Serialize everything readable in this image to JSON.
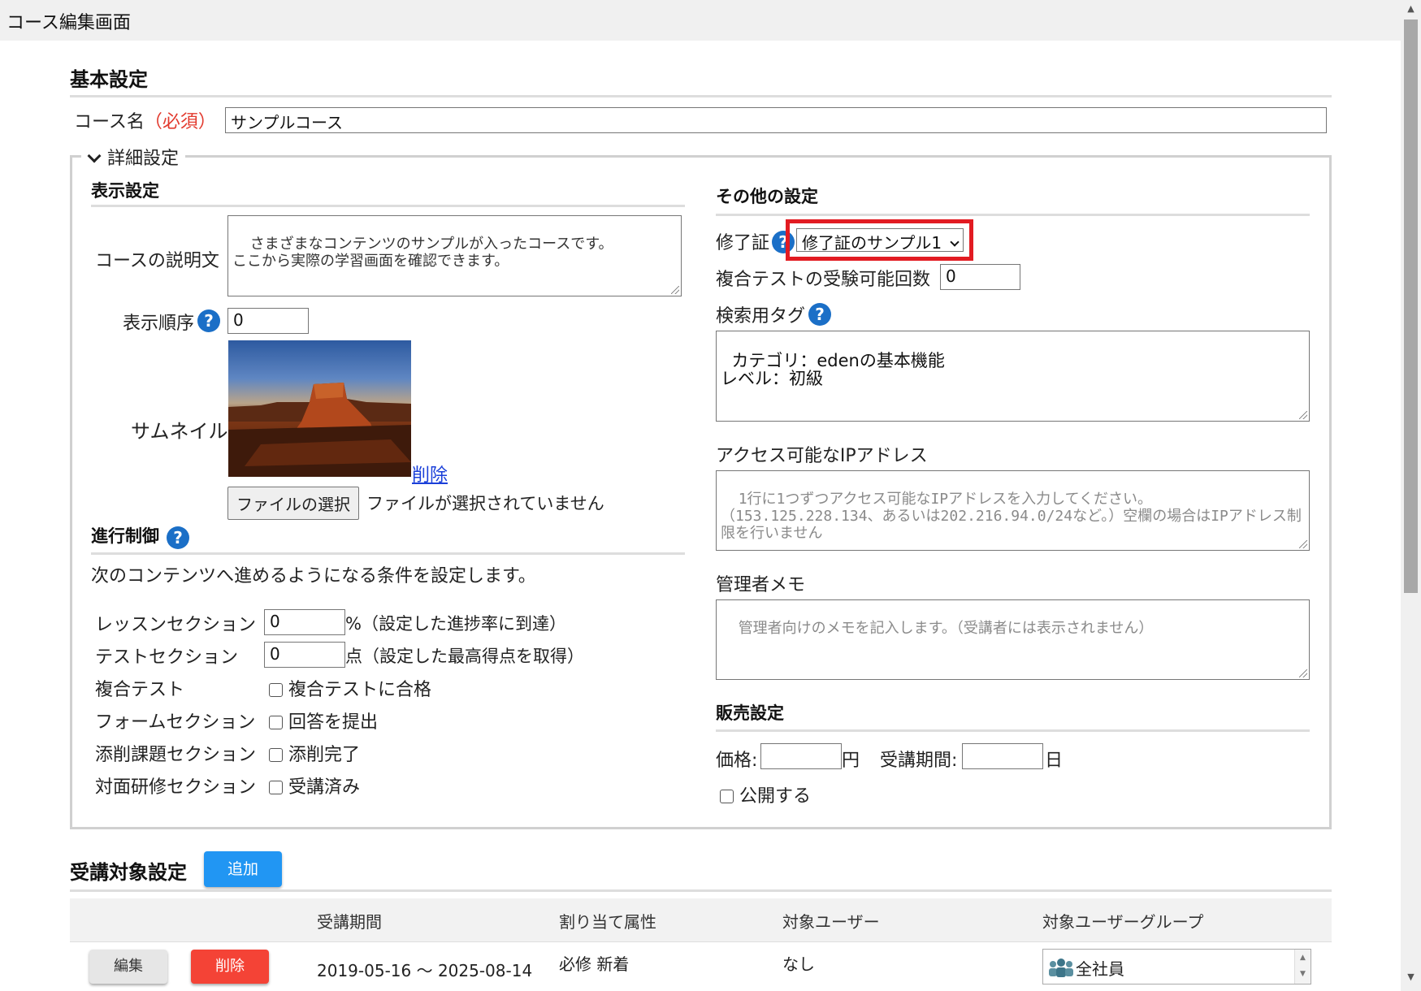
{
  "window": {
    "title": "コース編集画面"
  },
  "basic": {
    "heading": "基本設定",
    "course_name_label": "コース名",
    "required": "（必須）",
    "course_name_value": "サンプルコース"
  },
  "details": {
    "toggle_label": "詳細設定",
    "display": {
      "heading": "表示設定",
      "description_label": "コースの説明文",
      "description_value": "さまざまなコンテンツのサンプルが入ったコースです。\nここから実際の学習画面を確認できます。",
      "order_label": "表示順序",
      "order_value": "0",
      "thumbnail_label": "サムネイル",
      "delete_link": "削除",
      "file_button": "ファイルの選択",
      "file_status": "ファイルが選択されていません"
    },
    "progress": {
      "heading": "進行制御",
      "intro": "次のコンテンツへ進めるようになる条件を設定します。",
      "rows": [
        {
          "label": "レッスンセクション",
          "value": "0",
          "suffix": "%（設定した進捗率に到達）"
        },
        {
          "label": "テストセクション",
          "value": "0",
          "suffix": "点（設定した最高得点を取得）"
        }
      ],
      "checks": [
        {
          "label": "複合テスト",
          "option": "複合テストに合格"
        },
        {
          "label": "フォームセクション",
          "option": "回答を提出"
        },
        {
          "label": "添削課題セクション",
          "option": "添削完了"
        },
        {
          "label": "対面研修セクション",
          "option": "受講済み"
        }
      ]
    },
    "other": {
      "heading": "その他の設定",
      "certificate_label": "修了証",
      "certificate_value": "修了証のサンプル1",
      "attempts_label": "複合テストの受験可能回数",
      "attempts_value": "0",
      "tags_label": "検索用タグ",
      "tags_value": "カテゴリ：edenの基本機能\nレベル：初級",
      "ip_label": "アクセス可能なIPアドレス",
      "ip_placeholder": "1行に1つずつアクセス可能なIPアドレスを入力してください。\n（153.125.228.134、あるいは202.216.94.0/24など。）空欄の場合はIPアドレス制限を行いません",
      "memo_label": "管理者メモ",
      "memo_placeholder": "管理者向けのメモを記入します。（受講者には表示されません）"
    },
    "sales": {
      "heading": "販売設定",
      "price_label": "価格:",
      "price_unit": "円",
      "period_label": "受講期間:",
      "period_unit": "日",
      "publish_label": "公開する"
    }
  },
  "target": {
    "heading": "受講対象設定",
    "add_button": "追加",
    "columns": [
      "受講期間",
      "割り当て属性",
      "対象ユーザー",
      "対象ユーザーグループ"
    ],
    "rows": [
      {
        "edit": "編集",
        "delete": "削除",
        "period": "2019-05-16 〜 2025-08-14",
        "attributes": "必修 新着",
        "users": "なし",
        "group": "全社員"
      }
    ]
  },
  "icons": [
    "chevron-down-icon",
    "help-icon",
    "group-icon",
    "scroll-up-icon",
    "scroll-down-icon"
  ],
  "colors": {
    "accent": "#2196f3",
    "danger": "#f44336",
    "highlight": "#e21b22",
    "help": "#1b6fc7"
  }
}
